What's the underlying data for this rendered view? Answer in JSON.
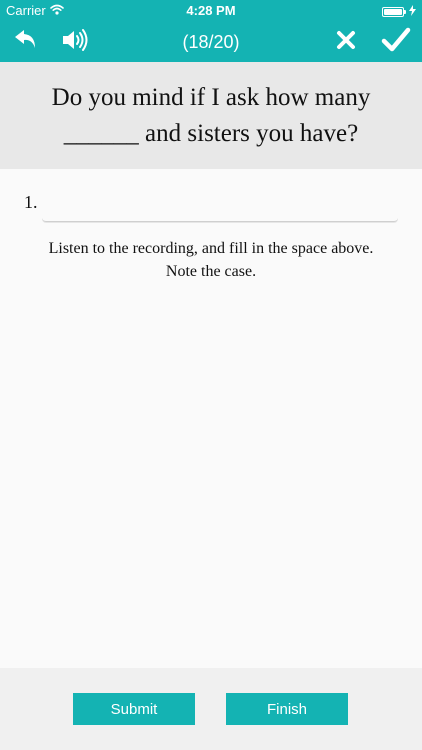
{
  "status_bar": {
    "carrier": "Carrier",
    "time": "4:28 PM"
  },
  "nav_bar": {
    "progress": "(18/20)"
  },
  "question": {
    "text": "Do you mind if I ask how many ______ and sisters you have?"
  },
  "answer": {
    "number": "1.",
    "value": "",
    "placeholder": ""
  },
  "instructions": {
    "line1": "Listen to the recording, and fill in the space above.",
    "line2": "Note the case."
  },
  "buttons": {
    "submit": "Submit",
    "finish": "Finish"
  },
  "icons": {
    "back": "undo-arrow-icon",
    "audio": "speaker-icon",
    "close": "close-icon",
    "confirm": "checkmark-icon",
    "wifi": "wifi-icon",
    "battery": "battery-icon",
    "charging": "lightning-icon"
  },
  "colors": {
    "accent": "#14b3b3",
    "question_bg": "#e8e8e8",
    "page_bg": "#fafafa",
    "bottom_bg": "#f0f0f0"
  }
}
